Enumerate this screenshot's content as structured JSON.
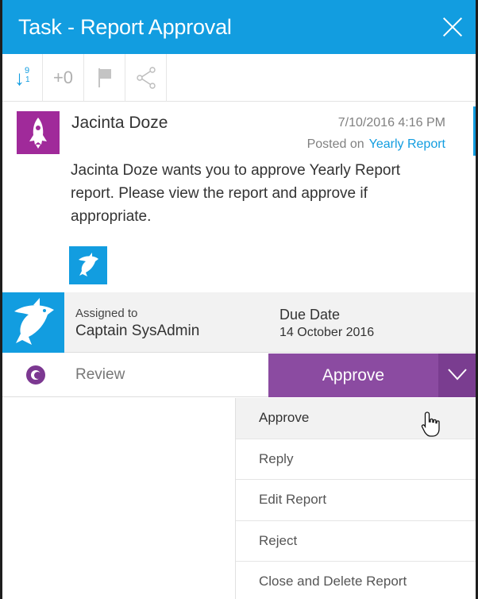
{
  "header": {
    "title": "Task - Report Approval",
    "close_icon": "close-icon"
  },
  "toolbar": {
    "sort_icon": "sort-numeric-icon",
    "sort_top": "9",
    "sort_bottom": "1",
    "plus_label": "+0",
    "flag_icon": "flag-icon",
    "share_icon": "share-icon"
  },
  "post": {
    "author": "Jacinta Doze",
    "timestamp": "7/10/2016 4:16 PM",
    "posted_on_label": "Posted on",
    "posted_on_link": "Yearly Report",
    "message": "Jacinta Doze wants you to approve Yearly Report report. Please view the report and approve if appropriate."
  },
  "assignment": {
    "assigned_label": "Assigned to",
    "assigned_value": "Captain SysAdmin",
    "due_label": "Due Date",
    "due_value": "14 October 2016"
  },
  "action": {
    "status": "Review",
    "primary": "Approve"
  },
  "dropdown": {
    "items": [
      {
        "label": "Approve"
      },
      {
        "label": "Reply"
      },
      {
        "label": "Edit Report"
      },
      {
        "label": "Reject"
      },
      {
        "label": "Close and Delete Report"
      }
    ]
  },
  "colors": {
    "header_blue": "#129de0",
    "avatar_purple": "#a02a9a",
    "approve_purple": "#8b4ba1",
    "approve_caret": "#7a3d90"
  }
}
